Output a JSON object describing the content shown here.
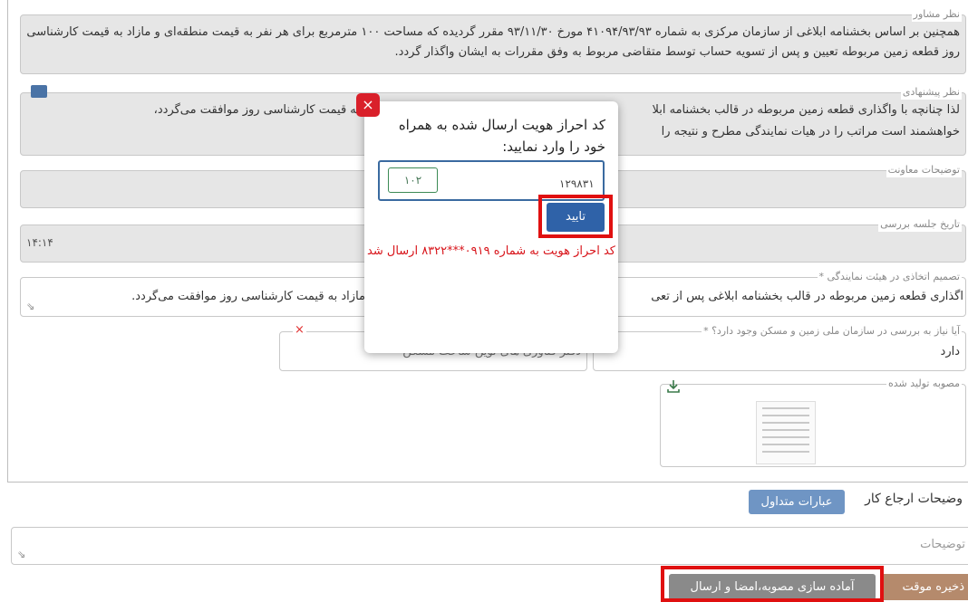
{
  "consultant": {
    "legend": "نظر مشاور",
    "text": "همچنین بر اساس بخشنامه ابلاغی از سازمان مرکزی به شماره ۴۱۰۹۴/۹۳/۹۳ مورخ ۹۳/۱۱/۳۰ مقرر گردیده که مساحت ۱۰۰ مترمربع برای هر نفر به قیمت منطقه‌ای و مازاد به قیمت کارشناسی روز قطعه زمین مربوطه تعیین و پس از تسویه حساب توسط متقاضی مربوط به وفق مقررات به ایشان واگذار گردد."
  },
  "proposal": {
    "legend": "نظر پیشنهادی",
    "line1_right": "لذا چنانچه با واگذاری قطعه زمین مربوطه در قالب بخشنامه ابلا",
    "line1_left": "۱۰ مترمربع و مازاد به قیمت کارشناسی روز موافقت می‌گردد،",
    "line2_right": "خواهشمند است مراتب را در هیات نمایندگی مطرح و نتیجه را"
  },
  "deputy": {
    "legend": "توضیحات معاونت"
  },
  "meeting_date": {
    "legend": "تاریخ جلسه بررسی",
    "value": "۱۴:۱۴"
  },
  "decision": {
    "legend": "* تصمیم اتخاذی در هیئت نمایندگی",
    "text_right": "اگذاری قطعه زمین مربوطه در قالب بخشنامه ابلاغی پس از تعی",
    "text_left": "مازاد به قیمت کارشناسی روز موافقت می‌گردد."
  },
  "national_land": {
    "legend": "* آیا نیاز به بررسی در سازمان ملی زمین و مسکن وجود دارد؟",
    "value": "دارد"
  },
  "office": {
    "value": "دفتر فناوری های نوین ساخت مسکن"
  },
  "generated_resolution": {
    "legend": "مصوبه تولید شده"
  },
  "referral": {
    "label": "وضیحات ارجاع کار",
    "common_phrases": "عبارات متداول"
  },
  "notes": {
    "placeholder": "توضیحات"
  },
  "actions": {
    "prepare_send": "آماده سازی مصوبه،امضا و ارسال",
    "temp_save": "ذخیره موقت"
  },
  "modal": {
    "title": "کد احراز هویت ارسال شده به همراه خود را وارد نمایید:",
    "captcha": "۱۰۲",
    "code_value": "۱۲۹۸۳۱",
    "confirm": "تایید",
    "message": "کد احراز هویت به شماره ۰۹۱۹***۸۳۲۲ ارسال شد",
    "close": "×"
  }
}
